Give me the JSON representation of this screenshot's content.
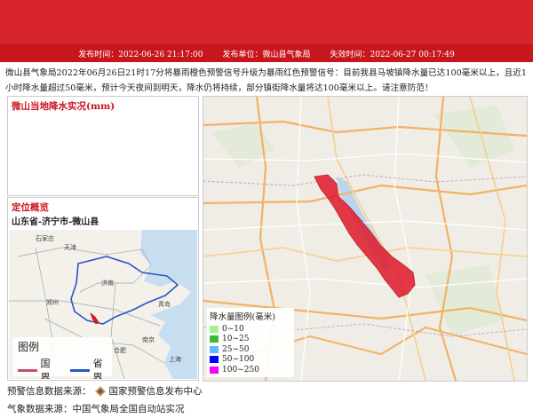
{
  "header": {
    "publish_time": "发布时间：2022-06-26 21:17:00",
    "publisher": "发布单位：微山县气象局",
    "expire_time": "失效时间：2022-06-27 00:17:49"
  },
  "description": "微山县气象局2022年06月26日21时17分将暴雨橙色预警信号升级为暴雨红色预警信号：目前我县马坡镇降水量已达100毫米以上，且近1小时降水量超过50毫米，预计今天夜间到明天，降水仍将持续，部分镇街降水量将达100毫米以上。请注意防范！",
  "rain_panel": {
    "title": "微山当地降水实况(mm)"
  },
  "location_panel": {
    "title": "定位概览",
    "path": "山东省-济宁市-微山县",
    "map_labels": [
      "天津",
      "石家庄",
      "济南",
      "郑州",
      "合肥",
      "南京",
      "上海",
      "青岛"
    ],
    "legend": {
      "title": "图例",
      "items": [
        {
          "label": "国界",
          "color": "#c0506a"
        },
        {
          "label": "省界",
          "color": "#2b55c8"
        }
      ]
    }
  },
  "main_map": {
    "legend": {
      "title": "降水量图例(毫米)",
      "items": [
        {
          "label": "0~10",
          "color": "#a6f28f"
        },
        {
          "label": "10~25",
          "color": "#3dba3d"
        },
        {
          "label": "25~50",
          "color": "#61b8ff"
        },
        {
          "label": "50~100",
          "color": "#0000fe"
        },
        {
          "label": "100~250",
          "color": "#fa00fa"
        }
      ]
    },
    "highlight_color": "#e0182a"
  },
  "footer": {
    "source_label": "预警信息数据来源：",
    "source_name": "国家预警信息发布中心",
    "station_line": "气象数据来源：中国气象局全国自动站实况"
  }
}
